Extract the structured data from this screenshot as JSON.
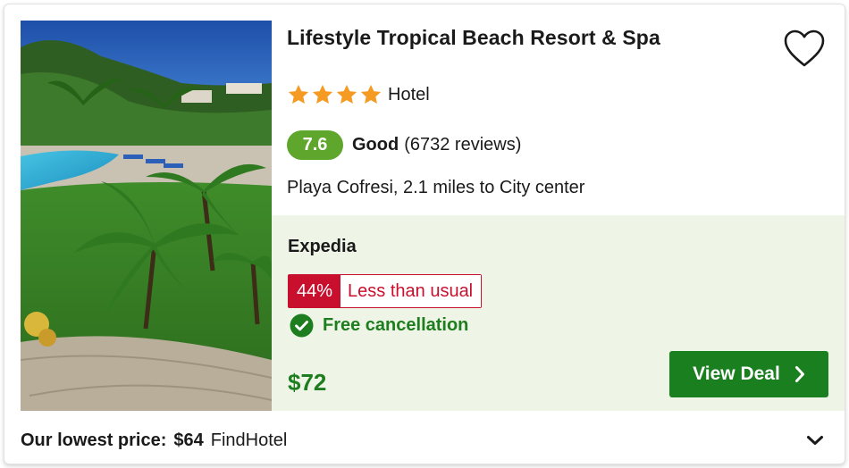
{
  "hotel": {
    "name": "Lifestyle Tropical Beach Resort & Spa",
    "star_rating": 4,
    "type": "Hotel",
    "score": "7.6",
    "score_word": "Good",
    "reviews": "(6732 reviews)",
    "location": "Playa Cofresi, 2.1 miles to City center",
    "photo_alt": "Resort pool and palm trees"
  },
  "deal": {
    "provider": "Expedia",
    "discount_percent": "44%",
    "discount_text": "Less than usual",
    "free_cancellation": "Free cancellation",
    "price": "$72",
    "button_label": "View Deal"
  },
  "footer": {
    "lowest_label": "Our lowest price:",
    "lowest_price": "$64",
    "lowest_provider": "FindHotel"
  },
  "icons": {
    "favorite": "heart-icon",
    "star": "star-icon",
    "check": "check-circle-icon",
    "chevron_right": "chevron-right-icon",
    "expand": "chevron-down-icon"
  },
  "colors": {
    "star": "#f59a23",
    "score_badge": "#5fa62c",
    "deal_panel_bg": "#eef5e6",
    "discount_red": "#c8102e",
    "green_text": "#1e7d1e",
    "button_green": "#1a7f1f"
  }
}
